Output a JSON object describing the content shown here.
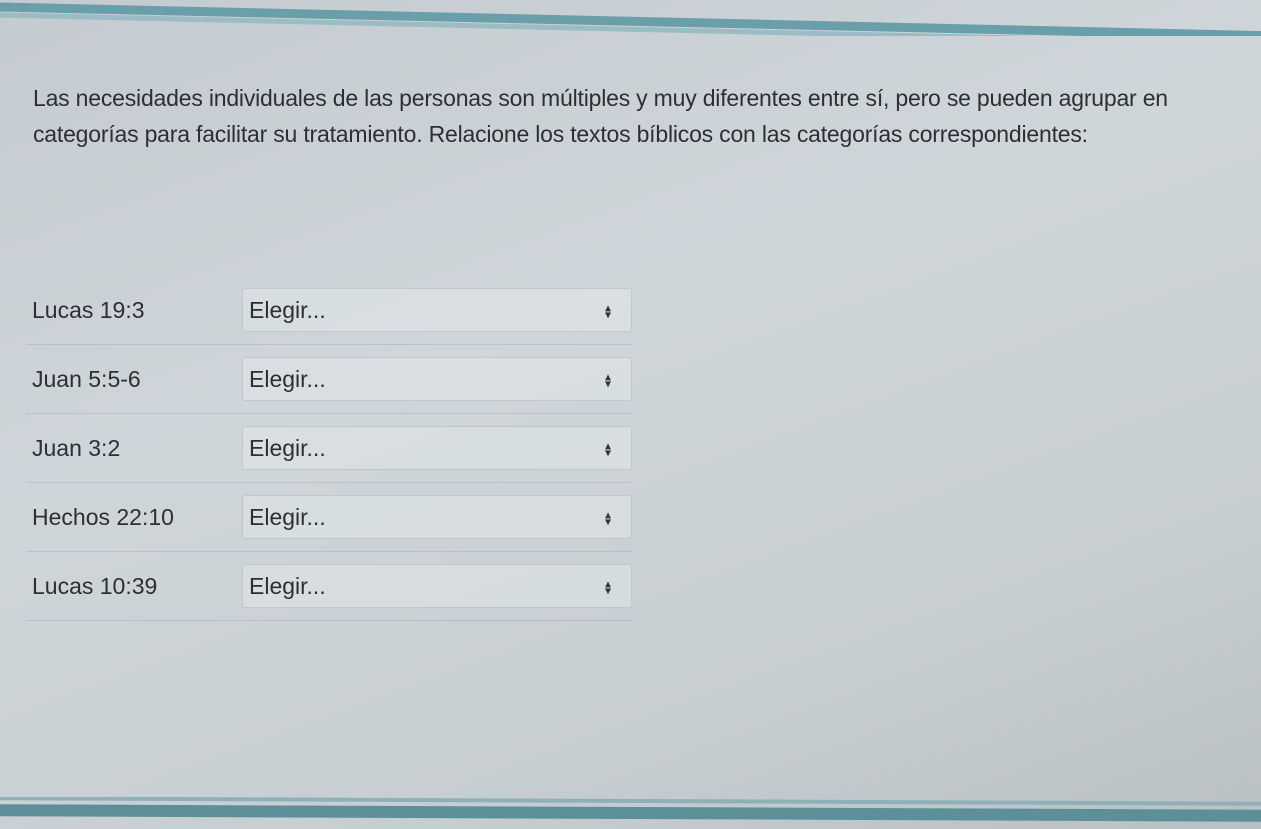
{
  "question": {
    "text": "Las necesidades individuales de las personas son múltiples y muy diferentes entre sí, pero se pueden agrupar en categorías para facilitar su tratamiento. Relacione los textos bíblicos con las categorías correspondientes:"
  },
  "matches": [
    {
      "reference": "Lucas 19:3",
      "selected": "Elegir..."
    },
    {
      "reference": "Juan 5:5-6",
      "selected": "Elegir..."
    },
    {
      "reference": "Juan 3:2",
      "selected": "Elegir..."
    },
    {
      "reference": "Hechos 22:10",
      "selected": "Elegir..."
    },
    {
      "reference": "Lucas 10:39",
      "selected": "Elegir..."
    }
  ],
  "icons": {
    "dropdown": "sort-arrows-icon"
  },
  "colors": {
    "border_band": "#6a9ea8",
    "text": "#2c2f33"
  }
}
